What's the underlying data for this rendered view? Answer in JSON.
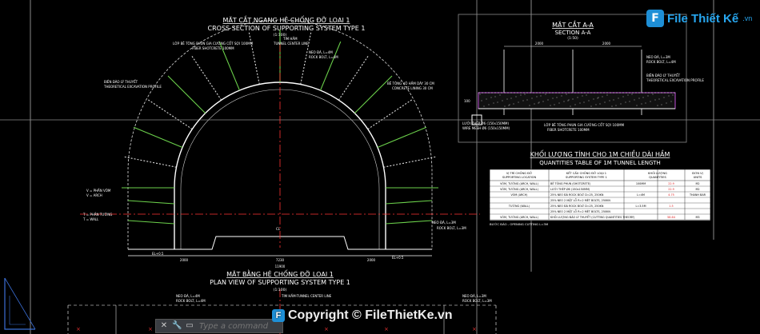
{
  "section1": {
    "title_vi": "MẶT CẮT NGANG HỆ CHỐNG ĐỠ LOẠI 1",
    "title_en": "CROSS SECTION OF SUPPORTING SYSTEM TYPE 1",
    "scale": "(1:100)",
    "labels": {
      "shotcrete": "LỚP BÊ TÔNG PHUN GIA CƯỜNG CỐT SỢI 100MM",
      "shotcrete_en": "FIBER SHOTCRETE 100MM",
      "tunnel_center": "TIM HẦM",
      "tunnel_center_en": "TUNNEL CENTER LINE",
      "rock_bolt": "NEO ĐÁ, L=4M",
      "rock_bolt_en": "ROCK BOLT, L=4M",
      "theoretical": "BIÊN ĐÀO LÝ THUYẾT",
      "theoretical_en": "THEORETICAL EXCAVATION PROFILE",
      "lining": "BÊ TÔNG VỎ HẦM DÀY 30 CM",
      "lining_en": "CONCRETE LINING 30 CM",
      "arch": "V = PHẦN VÒM",
      "arch_en": "V = ARCH",
      "wall": "T = PHẦN TƯỜNG",
      "wall_en": "T = WALL",
      "rock_bolt_2": "NEO ĐÁ, L=3M",
      "rock_bolt_2_en": "ROCK BOLT, L=3M",
      "dim_left": "2000",
      "dim_mid": "7230",
      "dim_right": "2000",
      "dim_total": "11900",
      "elev_left": "EL+0.5",
      "elev_right": "EL+0.5",
      "center_mark": "CL"
    }
  },
  "section_aa": {
    "title_vi": "MẶT CẮT A-A",
    "title_en": "SECTION A-A",
    "scale": "(1:50)",
    "dim1": "2000",
    "dim2": "2000",
    "height": "100",
    "rock_bolt": "NEO ĐÁ, L=3M",
    "rock_bolt_en": "ROCK BOLT, L=4M",
    "theoretical": "BIÊN ĐÀO LÝ THUYẾT",
    "theoretical_en": "THEORETICAL EXCAVATION PROFILE",
    "mesh": "LƯỚI THÉP Ø6 (150x150MM)",
    "mesh_en": "WIRE MESH Ø6 (150x150MM)",
    "shotcrete": "LỚP BÊ TÔNG PHUN GIA CƯỜNG CỐT SỢI 100MM",
    "shotcrete_en": "FIBER SHOTCRETE 100MM"
  },
  "table": {
    "title_vi": "KHỐI LƯỢNG TÍNH CHO 1M CHIỀU DÀI HẦM",
    "title_en": "QUANTITIES TABLE OF 1M TUNNEL LENGTH",
    "headers": [
      [
        "VỊ TRÍ CHỐNG ĐỠ",
        "SUPPORTING LOCATION"
      ],
      [
        "KẾT CẤU CHỐNG ĐỠ LOẠI 1",
        "SUPPORTING SYSTEM TYPE 1"
      ],
      [
        "KHỐI LƯỢNG",
        "QUANTITIES"
      ],
      [
        "ĐƠN VỊ",
        "UNITS"
      ]
    ],
    "rows": [
      [
        "VÒM, TƯỜNG (ARCH, WALL)",
        "BÊ TÔNG PHUN (SHOTCRETE)",
        "100MM",
        "22.9",
        "M2"
      ],
      [
        "VÒM, TƯỜNG (ARCH, WALL)",
        "LƯỚI THÉP Ø6 (150x150MM)",
        "",
        "22.9",
        "M2"
      ],
      [
        "VÒM (ARCH)",
        "25% NEO ĐÁ ROCK BOLT D=25, 250KN",
        "L=4M",
        "4.75",
        "THANH BAR"
      ],
      [
        "",
        "25% NEO 2 MẶT LỖ R=2 MÉT BOLTS, 250KN",
        "",
        "",
        ""
      ],
      [
        "TƯỜNG (WALL)",
        "25% NEO ĐÁ ROCK BOLT D=25, 250KN",
        "L=3.5M",
        "1.5",
        ""
      ],
      [
        "",
        "25% NEO 2 MẶT LỖ R=2 MÉT BOLTS, 250KN",
        "",
        "",
        ""
      ],
      [
        "VÒM, TƯỜNG (ARCH, WALL)",
        "KHỐI LƯỢNG ĐÀO LÝ THUYẾT (CUTTING QUANTITIES THEORY)",
        "",
        "58.64",
        "M3"
      ]
    ],
    "note": "BƯỚC ĐÀO - OPENING CUTTING L=3M"
  },
  "plan": {
    "title_vi": "MẶT BẰNG HỆ CHỐNG ĐỠ LOẠI 1",
    "title_en": "PLAN VIEW OF SUPPORTING SYSTEM TYPE 1",
    "scale": "(1:100)",
    "center": "TIM HẦM-TUNNEL CENTER LINE",
    "rock_bolt_left": "NEO ĐÁ, L=4M",
    "rock_bolt_left_en": "ROCK BOLT, L=4M",
    "rock_bolt_right": "NEO ĐÁ, L=3M",
    "rock_bolt_right_en": "ROCK BOLT, L=3M"
  },
  "command": {
    "placeholder": "Type a command"
  },
  "logo": {
    "mark": "F",
    "text": "File Thiết Kế",
    "domain": ".vn"
  },
  "watermark": {
    "text": "Copyright © FileThietKe.vn"
  },
  "colors": {
    "background": "#000000",
    "linework": "#ffffff",
    "bolts": "#6bd04b",
    "centerline": "#ff3333",
    "shotcrete": "#c04fd8",
    "table_bg": "#ffffff",
    "table_text": "#000000",
    "table_red": "#e02020"
  }
}
